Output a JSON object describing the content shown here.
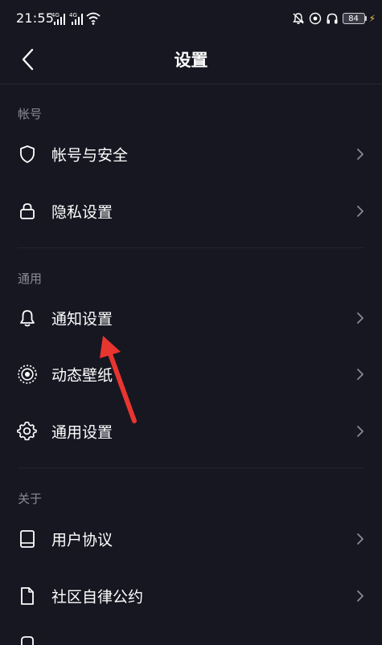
{
  "status_bar": {
    "time": "21:55",
    "signal_1_label": "4G",
    "signal_2_label": "4G",
    "battery_level": "84"
  },
  "header": {
    "title": "设置"
  },
  "sections": {
    "account": {
      "title": "帐号",
      "items": [
        {
          "label": "帐号与安全",
          "icon": "shield-icon"
        },
        {
          "label": "隐私设置",
          "icon": "lock-icon"
        }
      ]
    },
    "general": {
      "title": "通用",
      "items": [
        {
          "label": "通知设置",
          "icon": "bell-icon"
        },
        {
          "label": "动态壁纸",
          "icon": "live-wallpaper-icon"
        },
        {
          "label": "通用设置",
          "icon": "gear-icon"
        }
      ]
    },
    "about": {
      "title": "关于",
      "items": [
        {
          "label": "用户协议",
          "icon": "book-icon"
        },
        {
          "label": "社区自律公约",
          "icon": "document-icon"
        }
      ]
    }
  },
  "colors": {
    "background": "#171722",
    "text": "#ffffff",
    "section_header": "#8c8c96",
    "chevron": "#8a8a94",
    "annotation_arrow": "#e8352f",
    "battery_bolt": "#f6c744"
  }
}
